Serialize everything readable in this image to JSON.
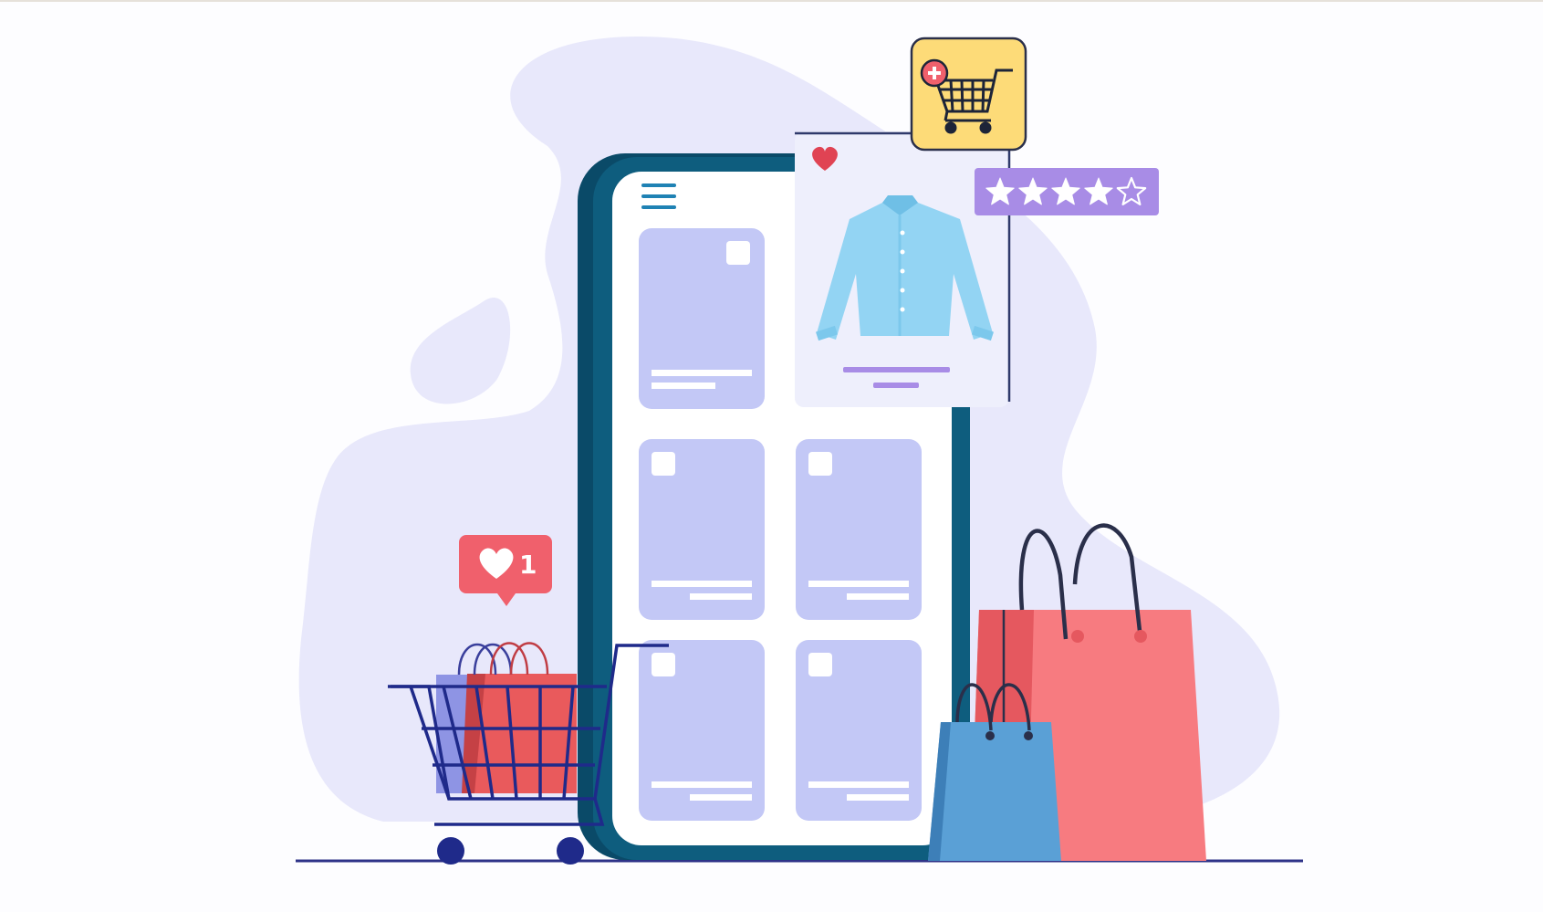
{
  "colors": {
    "background": "#fdfdff",
    "blob": "#e8e8fb",
    "phone_body": "#0e5d7e",
    "phone_edge": "#0a4a68",
    "card": "#c3c8f6",
    "product_card": "#eeeffc",
    "shirt": "#93d4f3",
    "rating_badge": "#a88ce6",
    "cart_badge": "#fddb78",
    "like_bubble": "#f0606c",
    "bag_red": "#f77b80",
    "bag_blue": "#5aa0d6",
    "cart_frame": "#1f2a8a",
    "ground": "#2e3388"
  },
  "icons": {
    "menu": "hamburger-menu-icon",
    "favorite": "heart-icon",
    "add_to_cart": "add-to-cart-icon",
    "rating": "star-icon",
    "like": "heart-icon"
  },
  "product": {
    "item": "shirt",
    "favorited": true
  },
  "rating": {
    "filled": 4,
    "total": 5
  },
  "like_notification": {
    "count": "1"
  },
  "product_grid": {
    "columns": 2,
    "rows": 3
  }
}
